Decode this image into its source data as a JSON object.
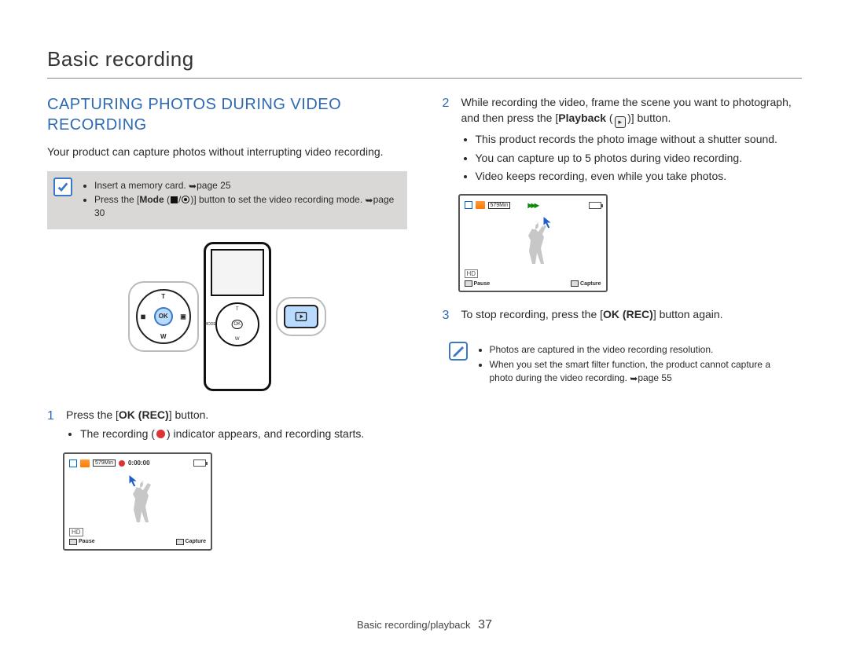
{
  "heading": "Basic recording",
  "title": "CAPTURING PHOTOS DURING VIDEO RECORDING",
  "intro": "Your product can capture photos without interrupting video recording.",
  "note1": {
    "item1": {
      "pre": "Insert a memory card. ",
      "ref": "page 25"
    },
    "item2": {
      "pre": "Press the [",
      "mode": "Mode",
      "post1": " (",
      "post2": ")] button to set the video recording mode. ",
      "ref": "page 30"
    }
  },
  "dpad": {
    "ok": "OK",
    "t": "T",
    "w": "W",
    "left": "◼",
    "right": "▣"
  },
  "device_small": {
    "mode": "MODE",
    "ok": "OK",
    "t": "T",
    "w": "W"
  },
  "step1": {
    "num": "1",
    "line_pre": "Press the [",
    "ok_rec": "OK (REC)",
    "line_post": "] button.",
    "bullet": "The recording () indicator appears, and recording starts."
  },
  "lcd1": {
    "min": "579Min",
    "timer": "0:00:00",
    "hd": "HD",
    "pause": "Pause",
    "capture": "Capture"
  },
  "step2": {
    "num": "2",
    "line_pre": "While recording the video, frame the scene you want to photograph, and then press the [",
    "playback": "Playback",
    "line_post": ")] button.",
    "bullet1": "This product records the photo image without a shutter sound.",
    "bullet2": "You can capture up to 5 photos during video recording.",
    "bullet3": "Video keeps recording, even while you take photos."
  },
  "lcd2": {
    "min": "579Min",
    "hd": "HD",
    "pause": "Pause",
    "capture": "Capture"
  },
  "step3": {
    "num": "3",
    "line_pre": "To stop recording, press the [",
    "ok_rec": "OK (REC)",
    "line_post": "] button again."
  },
  "note2": {
    "item1": "Photos are captured in the video recording resolution.",
    "item2": {
      "pre": "When you set the smart filter function, the product cannot capture a photo during the video recording. ",
      "ref": "page 55"
    }
  },
  "footer": {
    "section": "Basic recording/playback",
    "page": "37"
  }
}
